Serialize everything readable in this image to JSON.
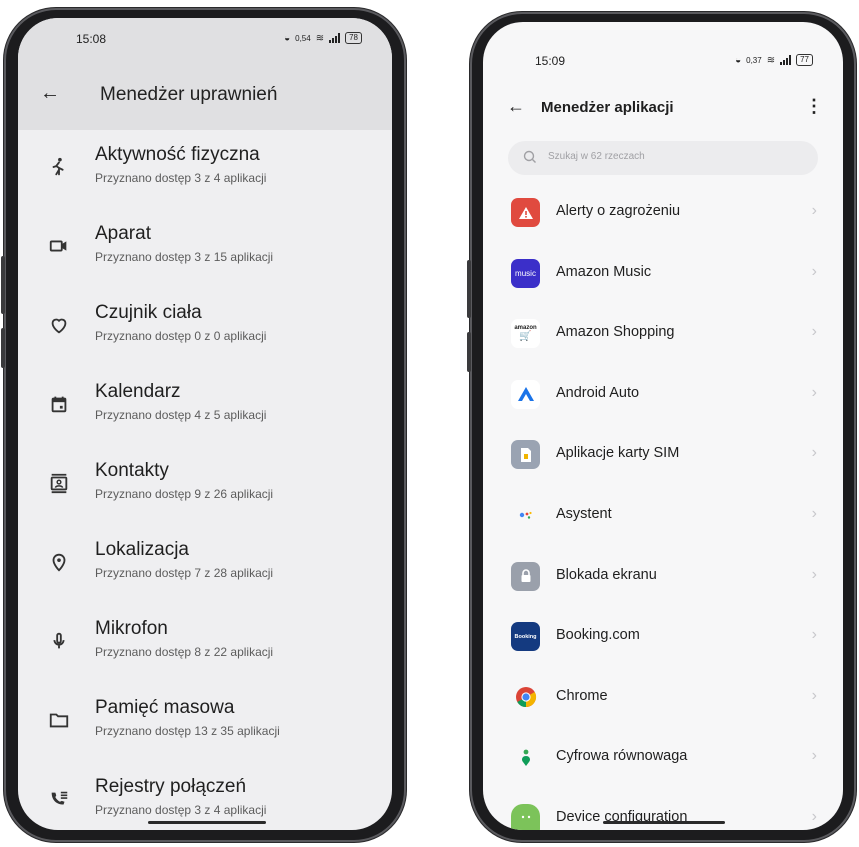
{
  "left": {
    "time": "15:08",
    "net_speed": "0,54",
    "battery": "78",
    "title": "Menedżer uprawnień",
    "items": [
      {
        "icon": "figure-walk-icon",
        "title": "Aktywność fizyczna",
        "subtitle": "Przyznano dostęp 3 z 4 aplikacji"
      },
      {
        "icon": "camera-icon",
        "title": "Aparat",
        "subtitle": "Przyznano dostęp 3 z 15 aplikacji"
      },
      {
        "icon": "heart-icon",
        "title": "Czujnik ciała",
        "subtitle": "Przyznano dostęp 0 z 0 aplikacji"
      },
      {
        "icon": "calendar-icon",
        "title": "Kalendarz",
        "subtitle": "Przyznano dostęp 4 z 5 aplikacji"
      },
      {
        "icon": "contacts-icon",
        "title": "Kontakty",
        "subtitle": "Przyznano dostęp 9 z 26 aplikacji"
      },
      {
        "icon": "location-pin-icon",
        "title": "Lokalizacja",
        "subtitle": "Przyznano dostęp 7 z 28 aplikacji"
      },
      {
        "icon": "microphone-icon",
        "title": "Mikrofon",
        "subtitle": "Przyznano dostęp 8 z 22 aplikacji"
      },
      {
        "icon": "folder-icon",
        "title": "Pamięć masowa",
        "subtitle": "Przyznano dostęp 13 z 35 aplikacji"
      },
      {
        "icon": "call-log-icon",
        "title": "Rejestry połączeń",
        "subtitle": "Przyznano dostęp 3 z 4 aplikacji"
      }
    ]
  },
  "right": {
    "time": "15:09",
    "net_speed": "0,37",
    "battery": "77",
    "title": "Menedżer aplikacji",
    "search_placeholder": "Szukaj w 62 rzeczach",
    "apps": [
      {
        "name": "Alerty o zagrożeniu",
        "icon": "warning-icon",
        "color": "#e04a3f",
        "glyph": "▲"
      },
      {
        "name": "Amazon Music",
        "icon": "amazon-music-icon",
        "color": "#3b2fc9",
        "glyph": "music"
      },
      {
        "name": "Amazon Shopping",
        "icon": "amazon-shopping-icon",
        "color": "#ffffff",
        "glyph": "amazon"
      },
      {
        "name": "Android Auto",
        "icon": "android-auto-icon",
        "color": "#ffffff",
        "glyph": "Λ"
      },
      {
        "name": "Aplikacje karty SIM",
        "icon": "sim-card-icon",
        "color": "#9aa3b2",
        "glyph": "▮"
      },
      {
        "name": "Asystent",
        "icon": "assistant-icon",
        "color": "#ffffff",
        "glyph": "•"
      },
      {
        "name": "Blokada ekranu",
        "icon": "lock-icon",
        "color": "#9aa0ab",
        "glyph": "🔒"
      },
      {
        "name": "Booking.com",
        "icon": "booking-icon",
        "color": "#143a80",
        "glyph": "Booking"
      },
      {
        "name": "Chrome",
        "icon": "chrome-icon",
        "color": "#ffffff",
        "glyph": "◉"
      },
      {
        "name": "Cyfrowa równowaga",
        "icon": "digital-wellbeing-icon",
        "color": "#ffffff",
        "glyph": "♣"
      },
      {
        "name": "Device configuration",
        "icon": "android-icon",
        "color": "#7cc35a",
        "glyph": ""
      }
    ]
  }
}
